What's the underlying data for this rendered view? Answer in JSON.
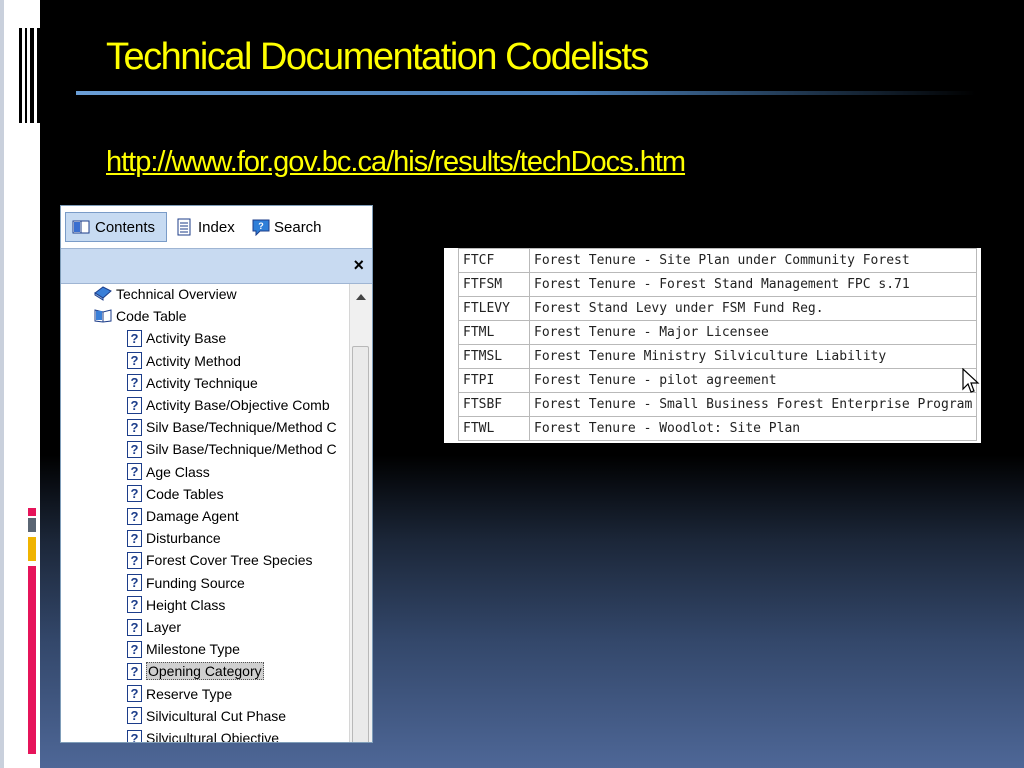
{
  "slide": {
    "title": "Technical Documentation Codelists",
    "link": "http://www.for.gov.bc.ca/his/results/techDocs.htm"
  },
  "help_panel": {
    "tabs": [
      {
        "label": "Contents",
        "icon": "book-icon",
        "active": true
      },
      {
        "label": "Index",
        "icon": "index-icon",
        "active": false
      },
      {
        "label": "Search",
        "icon": "search-icon",
        "active": false
      }
    ],
    "close_label": "×",
    "tree": [
      {
        "label": "Technical Overview",
        "icon": "book-closed-icon",
        "level": 0
      },
      {
        "label": "Code Table",
        "icon": "book-open-icon",
        "level": 0
      },
      {
        "label": "Activity Base",
        "icon": "help-page-icon",
        "level": 1
      },
      {
        "label": "Activity Method",
        "icon": "help-page-icon",
        "level": 1
      },
      {
        "label": "Activity Technique",
        "icon": "help-page-icon",
        "level": 1
      },
      {
        "label": "Activity Base/Objective Comb",
        "icon": "help-page-icon",
        "level": 1
      },
      {
        "label": "Silv Base/Technique/Method C",
        "icon": "help-page-icon",
        "level": 1
      },
      {
        "label": "Silv Base/Technique/Method C",
        "icon": "help-page-icon",
        "level": 1
      },
      {
        "label": "Age Class",
        "icon": "help-page-icon",
        "level": 1
      },
      {
        "label": "Code Tables",
        "icon": "help-page-icon",
        "level": 1
      },
      {
        "label": "Damage Agent",
        "icon": "help-page-icon",
        "level": 1
      },
      {
        "label": "Disturbance",
        "icon": "help-page-icon",
        "level": 1
      },
      {
        "label": "Forest Cover Tree Species",
        "icon": "help-page-icon",
        "level": 1
      },
      {
        "label": "Funding Source",
        "icon": "help-page-icon",
        "level": 1
      },
      {
        "label": "Height Class",
        "icon": "help-page-icon",
        "level": 1
      },
      {
        "label": "Layer",
        "icon": "help-page-icon",
        "level": 1
      },
      {
        "label": "Milestone Type",
        "icon": "help-page-icon",
        "level": 1
      },
      {
        "label": "Opening Category",
        "icon": "help-page-icon",
        "level": 1,
        "selected": true
      },
      {
        "label": "Reserve Type",
        "icon": "help-page-icon",
        "level": 1
      },
      {
        "label": "Silvicultural Cut Phase",
        "icon": "help-page-icon",
        "level": 1
      },
      {
        "label": "Silvicultural Objective",
        "icon": "help-page-icon",
        "level": 1
      }
    ]
  },
  "code_table": {
    "rows": [
      {
        "code": "FTCF",
        "description": "Forest Tenure - Site Plan under Community Forest"
      },
      {
        "code": "FTFSM",
        "description": "Forest Tenure - Forest Stand Management FPC s.71"
      },
      {
        "code": "FTLEVY",
        "description": "Forest Stand Levy under FSM Fund Reg."
      },
      {
        "code": "FTML",
        "description": "Forest Tenure - Major Licensee"
      },
      {
        "code": "FTMSL",
        "description": "Forest Tenure Ministry Silviculture Liability"
      },
      {
        "code": "FTPI",
        "description": "Forest Tenure - pilot agreement"
      },
      {
        "code": "FTSBF",
        "description": "Forest Tenure - Small Business Forest Enterprise Program"
      },
      {
        "code": "FTWL",
        "description": "Forest Tenure - Woodlot: Site Plan"
      }
    ]
  },
  "colors": {
    "title": "#ffff00",
    "accent_rule": "#4a7fb8",
    "accent_red": "#e6145a",
    "accent_yellow": "#f0b400",
    "accent_gray": "#5a6573",
    "tab_active": "#c7dbf2"
  }
}
